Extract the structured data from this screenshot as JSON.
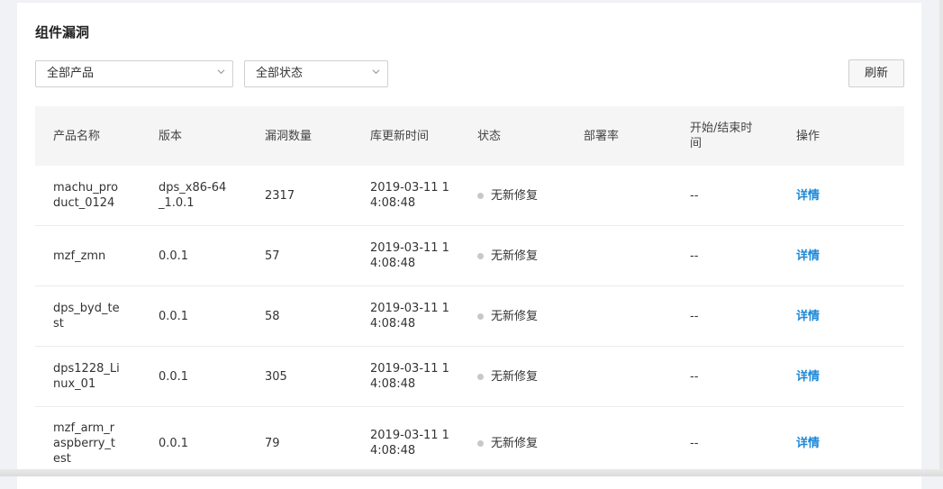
{
  "title": "组件漏洞",
  "filters": {
    "product": "全部产品",
    "status": "全部状态"
  },
  "refresh_label": "刷新",
  "columns": [
    "产品名称",
    "版本",
    "漏洞数量",
    "库更新时间",
    "状态",
    "部署率",
    "开始/结束时间",
    "操作"
  ],
  "rows": [
    {
      "name": "machu_product_0124",
      "version": "dps_x86-64_1.0.1",
      "count": "2317",
      "updated": "2019-03-11 14:08:48",
      "status": "无新修复",
      "rate": "",
      "time": "--",
      "action": "详情"
    },
    {
      "name": "mzf_zmn",
      "version": "0.0.1",
      "count": "57",
      "updated": "2019-03-11 14:08:48",
      "status": "无新修复",
      "rate": "",
      "time": "--",
      "action": "详情"
    },
    {
      "name": "dps_byd_test",
      "version": "0.0.1",
      "count": "58",
      "updated": "2019-03-11 14:08:48",
      "status": "无新修复",
      "rate": "",
      "time": "--",
      "action": "详情"
    },
    {
      "name": "dps1228_Linux_01",
      "version": "0.0.1",
      "count": "305",
      "updated": "2019-03-11 14:08:48",
      "status": "无新修复",
      "rate": "",
      "time": "--",
      "action": "详情"
    },
    {
      "name": "mzf_arm_raspberry_test",
      "version": "0.0.1",
      "count": "79",
      "updated": "2019-03-11 14:08:48",
      "status": "无新修复",
      "rate": "",
      "time": "--",
      "action": "详情"
    }
  ],
  "colors": {
    "link": "#1b87d8",
    "status_dot": "#c8c8c8",
    "header_bg": "#f5f5f5"
  },
  "icons": {
    "select_arrow": "chevron-down-icon",
    "status": "status-dot-icon"
  }
}
